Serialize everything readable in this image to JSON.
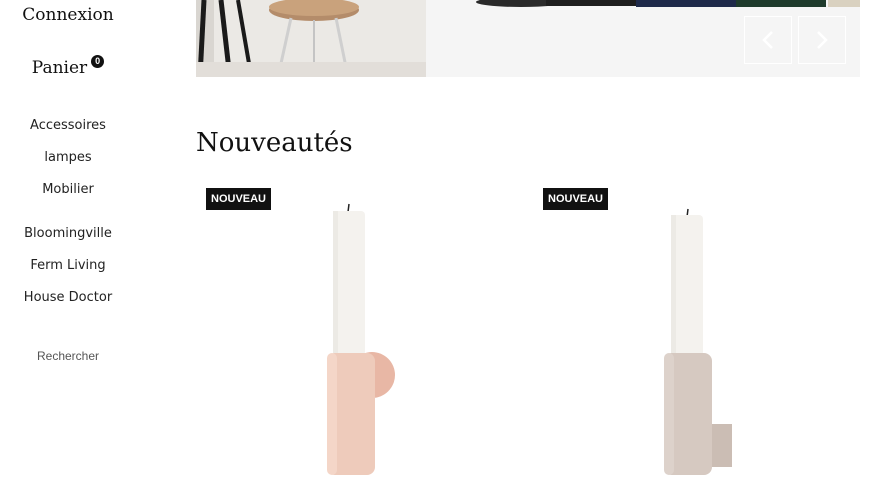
{
  "sidebar": {
    "login_label": "Connexion",
    "cart_label": "Panier",
    "cart_count": "0",
    "categories": [
      {
        "label": "Accessoires"
      },
      {
        "label": "lampes"
      },
      {
        "label": "Mobilier"
      }
    ],
    "brands": [
      {
        "label": "Bloomingville"
      },
      {
        "label": "Ferm Living"
      },
      {
        "label": "House Doctor"
      }
    ],
    "search_label": "Rechercher"
  },
  "hero": {
    "prev_icon": "chevron-left-icon",
    "next_icon": "chevron-right-icon"
  },
  "section": {
    "title": "Nouveautés"
  },
  "products": [
    {
      "badge": "NOUVEAU",
      "holder_color": "#eecbbb",
      "candle_color": "#f4f2ee"
    },
    {
      "badge": "NOUVEAU",
      "holder_color": "#d6c9c1",
      "candle_color": "#f4f2ee"
    }
  ],
  "colors": {
    "text": "#111111",
    "badge_bg": "#111111",
    "badge_text": "#ffffff"
  }
}
